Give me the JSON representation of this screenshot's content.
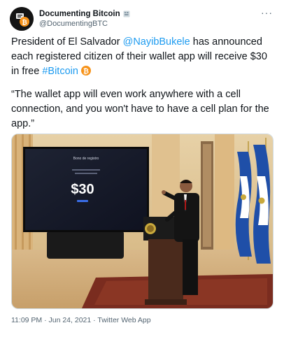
{
  "author": {
    "name": "Documenting Bitcoin",
    "handle": "@DocumentingBTC",
    "avatar_icon": "documenting-bitcoin-logo",
    "badge_icon": "affiliate-badge-icon"
  },
  "more_icon": "more-options-icon",
  "more_label": "···",
  "tweet": {
    "line1_prefix": "President of El Salvador ",
    "mention": "@NayibBukele",
    "line1_suffix": " has announced each registered citizen of their wallet app will receive $30 in free ",
    "hashtag": "#Bitcoin",
    "quote": "“The wallet app will even work anywhere with a cell connection, and you won't have to have a cell plan for the app.”"
  },
  "photo": {
    "screen_title": "Bono de registro",
    "screen_amount": "$30"
  },
  "footer": {
    "timestamp": "11:09 PM · Jun 24, 2021 · Twitter Web App"
  },
  "colors": {
    "link": "#1d9bf0",
    "bitcoin": "#f7931a"
  }
}
